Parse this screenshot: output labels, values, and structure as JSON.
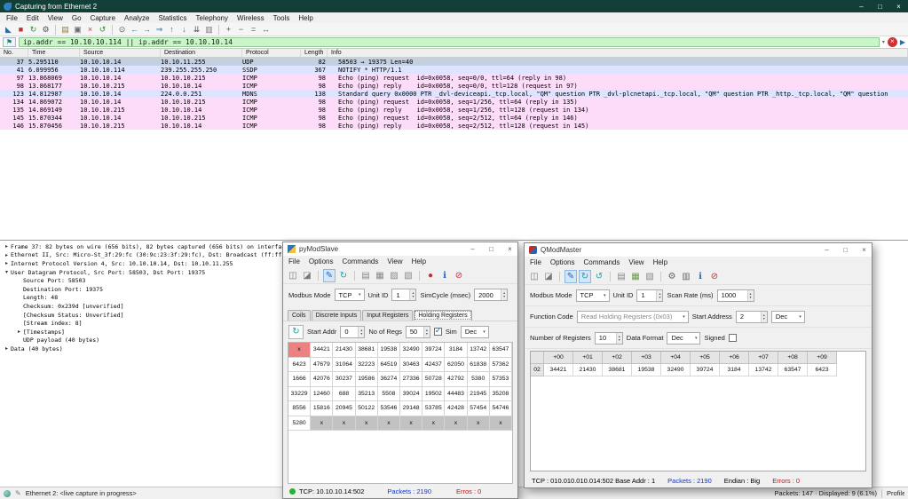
{
  "chrome": {
    "minimize": "–",
    "maximize": "□",
    "close": "×"
  },
  "wireshark": {
    "title": "Capturing from Ethernet 2",
    "menu": [
      "File",
      "Edit",
      "View",
      "Go",
      "Capture",
      "Analyze",
      "Statistics",
      "Telephony",
      "Wireless",
      "Tools",
      "Help"
    ],
    "toolbar": [
      {
        "name": "capture-fin-icon",
        "glyph": "◣",
        "color": "#2b6ca8"
      },
      {
        "name": "stop-capture-icon",
        "glyph": "■",
        "color": "#c03030"
      },
      {
        "name": "restart-capture-icon",
        "glyph": "↻",
        "color": "#2f8f2f"
      },
      {
        "name": "capture-options-icon",
        "glyph": "⚙",
        "color": "#555555"
      },
      {
        "sep": true
      },
      {
        "name": "open-file-icon",
        "glyph": "▤",
        "color": "#8a7a4a"
      },
      {
        "name": "save-file-icon",
        "glyph": "▣",
        "color": "#6a6a6a"
      },
      {
        "name": "close-file-icon",
        "glyph": "×",
        "color": "#b04040"
      },
      {
        "name": "reload-icon",
        "glyph": "↺",
        "color": "#2f8f2f"
      },
      {
        "sep": true
      },
      {
        "name": "find-packet-icon",
        "glyph": "⊙",
        "color": "#555555"
      },
      {
        "name": "go-back-icon",
        "glyph": "←",
        "color": "#2b6ca8"
      },
      {
        "name": "go-forward-icon",
        "glyph": "→",
        "color": "#2b6ca8"
      },
      {
        "name": "go-to-packet-icon",
        "glyph": "⇒",
        "color": "#2b6ca8"
      },
      {
        "name": "go-first-icon",
        "glyph": "↑",
        "color": "#2b6ca8"
      },
      {
        "name": "go-last-icon",
        "glyph": "↓",
        "color": "#2b6ca8"
      },
      {
        "name": "auto-scroll-icon",
        "glyph": "⇊",
        "color": "#555555"
      },
      {
        "name": "colorize-icon",
        "glyph": "▥",
        "color": "#777777"
      },
      {
        "sep": true
      },
      {
        "name": "zoom-in-icon",
        "glyph": "+",
        "color": "#555555"
      },
      {
        "name": "zoom-out-icon",
        "glyph": "−",
        "color": "#555555"
      },
      {
        "name": "zoom-100-icon",
        "glyph": "=",
        "color": "#555555"
      },
      {
        "name": "resize-columns-icon",
        "glyph": "↔",
        "color": "#555555"
      }
    ],
    "filter": {
      "bookmark_glyph": "⚑",
      "value": "ip.addr == 10.10.10.114 || ip.addr == 10.10.10.14",
      "clear_glyph": "×",
      "apply_glyph": "▶",
      "caret_glyph": "▾"
    },
    "columns": [
      "No.",
      "Time",
      "Source",
      "Destination",
      "Protocol",
      "Length",
      "Info"
    ],
    "packets": [
      {
        "no": "37",
        "time": "5.295110",
        "src": "10.10.10.14",
        "dst": "10.10.11.255",
        "proto": "UDP",
        "len": "82",
        "info": "58503 → 19375 Len=40",
        "color": "selected"
      },
      {
        "no": "41",
        "time": "6.099956",
        "src": "10.10.10.114",
        "dst": "239.255.255.250",
        "proto": "SSDP",
        "len": "367",
        "info": "NOTIFY * HTTP/1.1",
        "color": "udp"
      },
      {
        "no": "97",
        "time": "13.868069",
        "src": "10.10.10.14",
        "dst": "10.10.10.215",
        "proto": "ICMP",
        "len": "98",
        "info": "Echo (ping) request  id=0x0058, seq=0/0, ttl=64 (reply in 98)",
        "color": "icmp"
      },
      {
        "no": "98",
        "time": "13.868177",
        "src": "10.10.10.215",
        "dst": "10.10.10.14",
        "proto": "ICMP",
        "len": "98",
        "info": "Echo (ping) reply    id=0x0058, seq=0/0, ttl=128 (request in 97)",
        "color": "icmp"
      },
      {
        "no": "123",
        "time": "14.812987",
        "src": "10.10.10.14",
        "dst": "224.0.0.251",
        "proto": "MDNS",
        "len": "138",
        "info": "Standard query 0x0000 PTR _dvl-deviceapi._tcp.local, \"QM\" question PTR _dvl-plcnetapi._tcp.local, \"QM\" question PTR _http._tcp.local, \"QM\" question",
        "color": "udp"
      },
      {
        "no": "134",
        "time": "14.869072",
        "src": "10.10.10.14",
        "dst": "10.10.10.215",
        "proto": "ICMP",
        "len": "98",
        "info": "Echo (ping) request  id=0x0058, seq=1/256, ttl=64 (reply in 135)",
        "color": "icmp"
      },
      {
        "no": "135",
        "time": "14.869149",
        "src": "10.10.10.215",
        "dst": "10.10.10.14",
        "proto": "ICMP",
        "len": "98",
        "info": "Echo (ping) reply    id=0x0058, seq=1/256, ttl=128 (request in 134)",
        "color": "icmp"
      },
      {
        "no": "145",
        "time": "15.870344",
        "src": "10.10.10.14",
        "dst": "10.10.10.215",
        "proto": "ICMP",
        "len": "98",
        "info": "Echo (ping) request  id=0x0058, seq=2/512, ttl=64 (reply in 146)",
        "color": "icmp"
      },
      {
        "no": "146",
        "time": "15.870456",
        "src": "10.10.10.215",
        "dst": "10.10.10.14",
        "proto": "ICMP",
        "len": "98",
        "info": "Echo (ping) reply    id=0x0058, seq=2/512, ttl=128 (request in 145)",
        "color": "icmp"
      }
    ],
    "details": [
      {
        "depth": 0,
        "arrow": "▸",
        "text": "Frame 37: 82 bytes on wire (656 bits), 82 bytes captured (656 bits) on interfac"
      },
      {
        "depth": 0,
        "arrow": "▸",
        "text": "Ethernet II, Src: Micro-St_3f:29:fc (30:9c:23:3f:29:fc), Dst: Broadcast (ff:ff:"
      },
      {
        "depth": 0,
        "arrow": "▸",
        "text": "Internet Protocol Version 4, Src: 10.10.10.14, Dst: 10.10.11.255"
      },
      {
        "depth": 0,
        "arrow": "▾",
        "text": "User Datagram Protocol, Src Port: 58503, Dst Port: 19375"
      },
      {
        "depth": 1,
        "arrow": "",
        "text": "Source Port: 58503"
      },
      {
        "depth": 1,
        "arrow": "",
        "text": "Destination Port: 19375"
      },
      {
        "depth": 1,
        "arrow": "",
        "text": "Length: 48"
      },
      {
        "depth": 1,
        "arrow": "",
        "text": "Checksum: 0x239d [unverified]"
      },
      {
        "depth": 1,
        "arrow": "",
        "text": "[Checksum Status: Unverified]"
      },
      {
        "depth": 1,
        "arrow": "",
        "text": "[Stream index: 8]"
      },
      {
        "depth": 1,
        "arrow": "▸",
        "text": "[Timestamps]"
      },
      {
        "depth": 1,
        "arrow": "",
        "text": "UDP payload (40 bytes)"
      },
      {
        "depth": 0,
        "arrow": "▸",
        "text": "Data (40 bytes)"
      }
    ],
    "status": {
      "left": "Ethernet 2: <live capture in progress>",
      "packets": "Packets: 147 · Displayed: 9 (6.1%)",
      "profile": "Profile"
    }
  },
  "pymodslave": {
    "title": "pyModSlave",
    "menu": [
      "File",
      "Options",
      "Commands",
      "View",
      "Help"
    ],
    "toolbar": [
      {
        "name": "connect-icon",
        "glyph": "◫",
        "color": "#777777"
      },
      {
        "name": "disconnect-icon",
        "glyph": "◪",
        "color": "#777777"
      },
      {
        "sep": true
      },
      {
        "name": "edit-registers-icon",
        "glyph": "✎",
        "color": "#1d64c8",
        "active": true
      },
      {
        "name": "reset-counters-icon",
        "glyph": "↻",
        "color": "#18a0a8"
      },
      {
        "sep": true
      },
      {
        "name": "log-icon",
        "glyph": "▤",
        "color": "#888888"
      },
      {
        "name": "headers-icon",
        "glyph": "▦",
        "color": "#888888"
      },
      {
        "name": "serial-settings-icon",
        "glyph": "▨",
        "color": "#888888"
      },
      {
        "name": "tcp-settings-icon",
        "glyph": "▧",
        "color": "#888888"
      },
      {
        "sep": true
      },
      {
        "name": "start-stop-icon",
        "glyph": "●",
        "color": "#c03030"
      },
      {
        "name": "about-icon",
        "glyph": "ℹ",
        "color": "#1d64c8"
      },
      {
        "name": "exit-icon",
        "glyph": "⊘",
        "color": "#c03030"
      }
    ],
    "params": {
      "mode_label": "Modbus Mode",
      "mode": "TCP",
      "unit_label": "Unit ID",
      "unit": "1",
      "cycle_label": "SimCycle (msec)",
      "cycle": "2000"
    },
    "tabs": [
      "Coils",
      "Discrete Inputs",
      "Input Registers",
      "Holding Registers"
    ],
    "active_tab": "Holding Registers",
    "regbar": {
      "refresh_glyph": "↻",
      "start_label": "Start Addr",
      "start": "0",
      "regs_label": "No of Regs",
      "regs": "50",
      "sim_label": "Sim",
      "format": "Dec"
    },
    "grid": [
      [
        "x",
        "34421",
        "21430",
        "38681",
        "19538",
        "32490",
        "39724",
        "3184",
        "13742",
        "63547"
      ],
      [
        "6423",
        "47679",
        "31064",
        "32223",
        "64519",
        "30463",
        "42437",
        "62050",
        "61838",
        "57362"
      ],
      [
        "1666",
        "42076",
        "30237",
        "19586",
        "36274",
        "27336",
        "50728",
        "42792",
        "5380",
        "57353"
      ],
      [
        "33229",
        "12460",
        "688",
        "35213",
        "5508",
        "39024",
        "19502",
        "44483",
        "21945",
        "35208"
      ],
      [
        "8556",
        "15816",
        "20945",
        "50122",
        "53546",
        "29148",
        "53785",
        "42428",
        "57454",
        "54746"
      ],
      [
        "5280",
        "x",
        "x",
        "x",
        "x",
        "x",
        "x",
        "x",
        "x",
        "x"
      ]
    ],
    "status": {
      "connection": "TCP: 10.10.10.14:502",
      "packets": "Packets : 2190",
      "errors": "Erros : 0"
    }
  },
  "qmodmaster": {
    "title": "QModMaster",
    "menu": [
      "File",
      "Options",
      "Commands",
      "View",
      "Help"
    ],
    "toolbar": [
      {
        "name": "connect-icon",
        "glyph": "◫",
        "color": "#777777"
      },
      {
        "name": "disconnect-icon",
        "glyph": "◪",
        "color": "#777777"
      },
      {
        "sep": true
      },
      {
        "name": "edit-icon",
        "glyph": "✎",
        "color": "#1d64c8",
        "active": true
      },
      {
        "name": "scan-icon",
        "glyph": "↻",
        "color": "#18a0a8",
        "active": true
      },
      {
        "name": "request-icon",
        "glyph": "↺",
        "color": "#18a0a8"
      },
      {
        "sep": true
      },
      {
        "name": "read-data-icon",
        "glyph": "▤",
        "color": "#888888"
      },
      {
        "name": "write-data-icon",
        "glyph": "▦",
        "color": "#6a9a4a"
      },
      {
        "name": "raw-data-icon",
        "glyph": "▧",
        "color": "#888888"
      },
      {
        "sep": true
      },
      {
        "name": "modbus-settings-icon",
        "glyph": "⚙",
        "color": "#666666"
      },
      {
        "name": "bus-monitor-icon",
        "glyph": "▥",
        "color": "#666666"
      },
      {
        "name": "about-icon",
        "glyph": "ℹ",
        "color": "#1d64c8"
      },
      {
        "name": "exit-icon",
        "glyph": "⊘",
        "color": "#c03030"
      }
    ],
    "row1": {
      "mode_label": "Modbus Mode",
      "mode": "TCP",
      "unit_label": "Unit ID",
      "unit": "1",
      "scan_label": "Scan Rate (ms)",
      "scan": "1000"
    },
    "row2": {
      "func_label": "Function Code",
      "func": "Read Holding Registers (0x03)",
      "start_label": "Start Address",
      "start": "2",
      "format": "Dec"
    },
    "row3": {
      "regs_label": "Number of Registers",
      "regs": "10",
      "fmt_label": "Data Format",
      "fmt": "Dec",
      "signed_label": "Signed"
    },
    "table": {
      "headers": [
        "+00",
        "+01",
        "+02",
        "+03",
        "+04",
        "+05",
        "+06",
        "+07",
        "+08",
        "+09"
      ],
      "row_label": "02",
      "values": [
        "34421",
        "21430",
        "38681",
        "19538",
        "32490",
        "39724",
        "3184",
        "13742",
        "63547",
        "6423"
      ]
    },
    "status": {
      "connection": "TCP : 010.010.010.014:502 Base Addr : 1",
      "packets": "Packets : 2190",
      "endian": "Endian : Big",
      "errors": "Errors : 0"
    }
  }
}
